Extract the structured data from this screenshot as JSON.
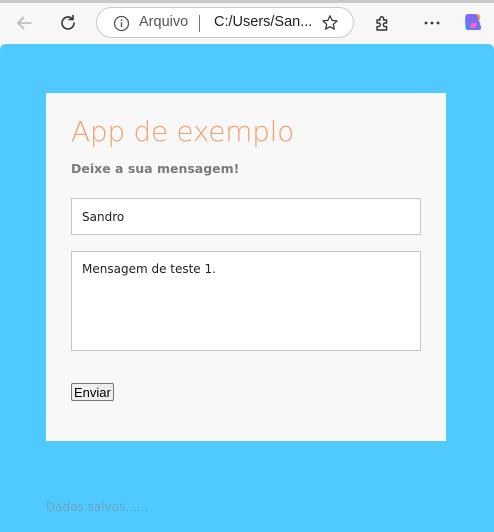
{
  "browser": {
    "address_label": "Arquivo",
    "url": "C:/Users/San..."
  },
  "app": {
    "title": "App de exemplo",
    "subtitle": "Deixe a sua mensagem!",
    "name_value": "Sandro",
    "message_value": "Mensagem de teste 1.",
    "send_label": "Enviar",
    "status": "Dados salvos......"
  },
  "colors": {
    "page_background": "#50cafe",
    "card_background": "#f8f8f8",
    "title": "#f39f6a"
  },
  "icons": [
    "back-arrow-icon",
    "refresh-icon",
    "info-icon",
    "favorite-star-icon",
    "extensions-icon",
    "more-menu-icon",
    "copilot-icon"
  ]
}
